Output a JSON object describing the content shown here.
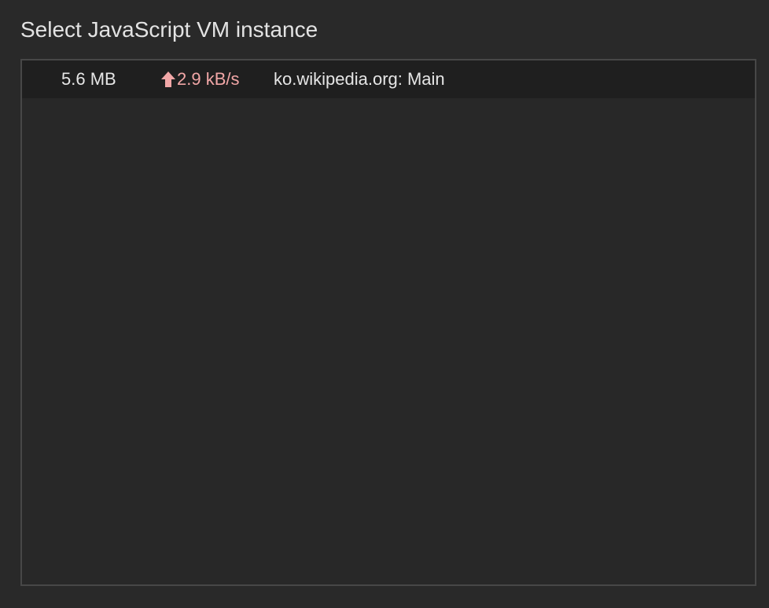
{
  "header": {
    "title": "Select JavaScript VM instance"
  },
  "vm_list": {
    "items": [
      {
        "heap_size": "5.6 MB",
        "rate": "2.9 kB/s",
        "rate_icon": "up-arrow-icon",
        "name": "ko.wikipedia.org: Main"
      }
    ]
  },
  "colors": {
    "background": "#292929",
    "list_background": "#282828",
    "row_background": "#1f1f1f",
    "border": "#474747",
    "rate_accent": "#f2a7a7",
    "text": "#e6e6e6"
  }
}
